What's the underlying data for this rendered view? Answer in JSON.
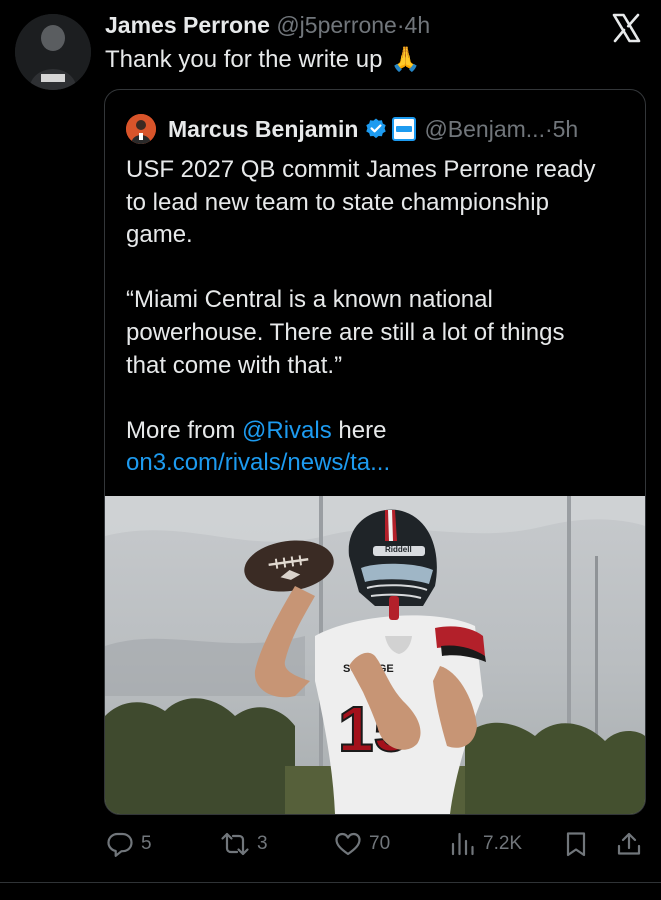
{
  "tweet": {
    "author_name": "James Perrone",
    "author_handle": "@j5perrone",
    "separator": "·",
    "time": "4h",
    "text": "Thank you for the write up",
    "emoji": "🙏"
  },
  "quote": {
    "author_name": "Marcus Benjamin",
    "affiliate": "rivals",
    "handle": "@Benjam...",
    "separator": "·",
    "time": "5h",
    "line1": "USF 2027 QB commit James Perrone ready",
    "line2": "to lead new team to state championship",
    "line3": "game.",
    "quote_line1": "“Miami Central is a known national",
    "quote_line2": "powerhouse. There are still a lot of things",
    "quote_line3": "that come with that.”",
    "more_prefix": "More from ",
    "more_mention": "@Rivals",
    "more_suffix": " here",
    "link": "on3.com/rivals/news/ta...",
    "jersey_number": "15",
    "jersey_text": "SOU  DGE",
    "helmet_brand": "Riddell"
  },
  "actions": {
    "replies": "5",
    "reposts": "3",
    "likes": "70",
    "views": "7.2K"
  },
  "icons": [
    "x-logo-icon",
    "verified-icon",
    "reply-icon",
    "repost-icon",
    "like-icon",
    "views-icon",
    "bookmark-icon",
    "share-icon"
  ],
  "colors": {
    "background": "#000000",
    "text": "#e7e9ea",
    "muted": "#71767b",
    "link": "#1d9bf0",
    "border": "#333639"
  }
}
